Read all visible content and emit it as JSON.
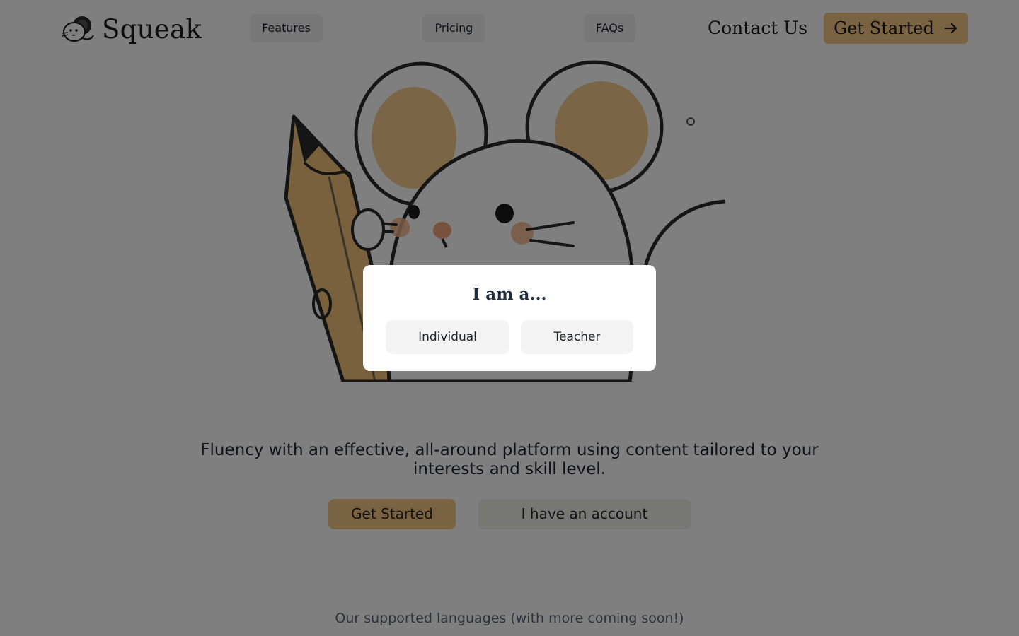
{
  "brand": {
    "name": "Squeak",
    "accent": "#f3c784"
  },
  "nav": {
    "features": "Features",
    "pricing": "Pricing",
    "faqs": "FAQs",
    "contact": "Contact Us",
    "cta": "Get Started"
  },
  "hero": {
    "tagline": "Fluency with an effective, all-around platform using content tailored to your interests and skill level.",
    "primary_button": "Get Started",
    "secondary_button": "I have an account",
    "illustration": "mouse-holding-pencil"
  },
  "languages": {
    "heading": "Our supported languages (with more coming soon!)"
  },
  "modal": {
    "title": "I am a...",
    "options": [
      "Individual",
      "Teacher"
    ]
  },
  "colors": {
    "overlay": "rgba(0,0,0,0.5)",
    "modal_bg": "#ffffff"
  }
}
